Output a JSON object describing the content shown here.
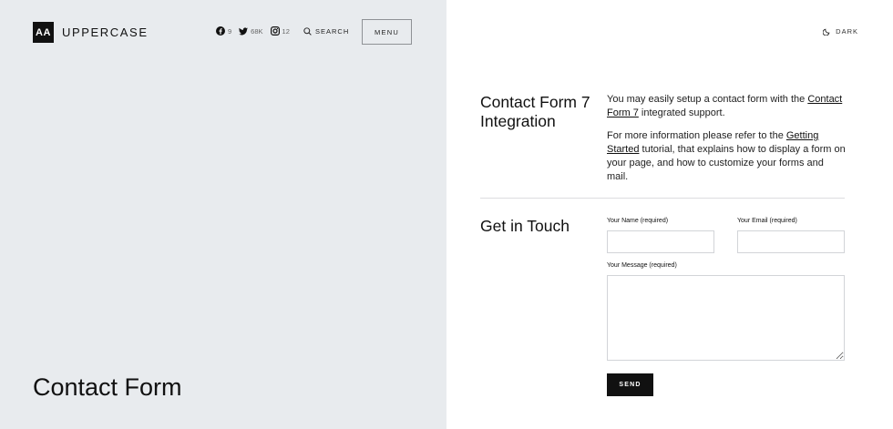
{
  "header": {
    "logo_mark": "AA",
    "logo_text": "UPPERCASE",
    "social": [
      {
        "icon": "facebook-icon",
        "count": "9"
      },
      {
        "icon": "twitter-icon",
        "count": "68K"
      },
      {
        "icon": "instagram-icon",
        "count": "12"
      }
    ],
    "search_label": "SEARCH",
    "menu_label": "MENU",
    "dark_label": "DARK"
  },
  "hero": {
    "title": "Contact Form"
  },
  "sections": {
    "integration": {
      "heading": "Contact Form 7 Integration",
      "p1_pre": "You may easily setup a contact form with the ",
      "p1_link": "Contact Form 7",
      "p1_post": " integrated support.",
      "p2_pre": "For more information please refer to the ",
      "p2_link": "Getting Started",
      "p2_post": " tutorial, that explains how to display a form on your page, and how to customize your forms and mail."
    },
    "contact": {
      "heading": "Get in Touch",
      "name_label": "Your Name (required)",
      "email_label": "Your Email (required)",
      "message_label": "Your Message (required)",
      "name_value": "",
      "email_value": "",
      "message_value": "",
      "send_label": "SEND"
    }
  },
  "colors": {
    "left_panel_bg": "#e8ebee",
    "right_panel_bg": "#ffffff",
    "text": "#111111",
    "button_bg": "#111111",
    "input_border": "#d2d4d8"
  }
}
